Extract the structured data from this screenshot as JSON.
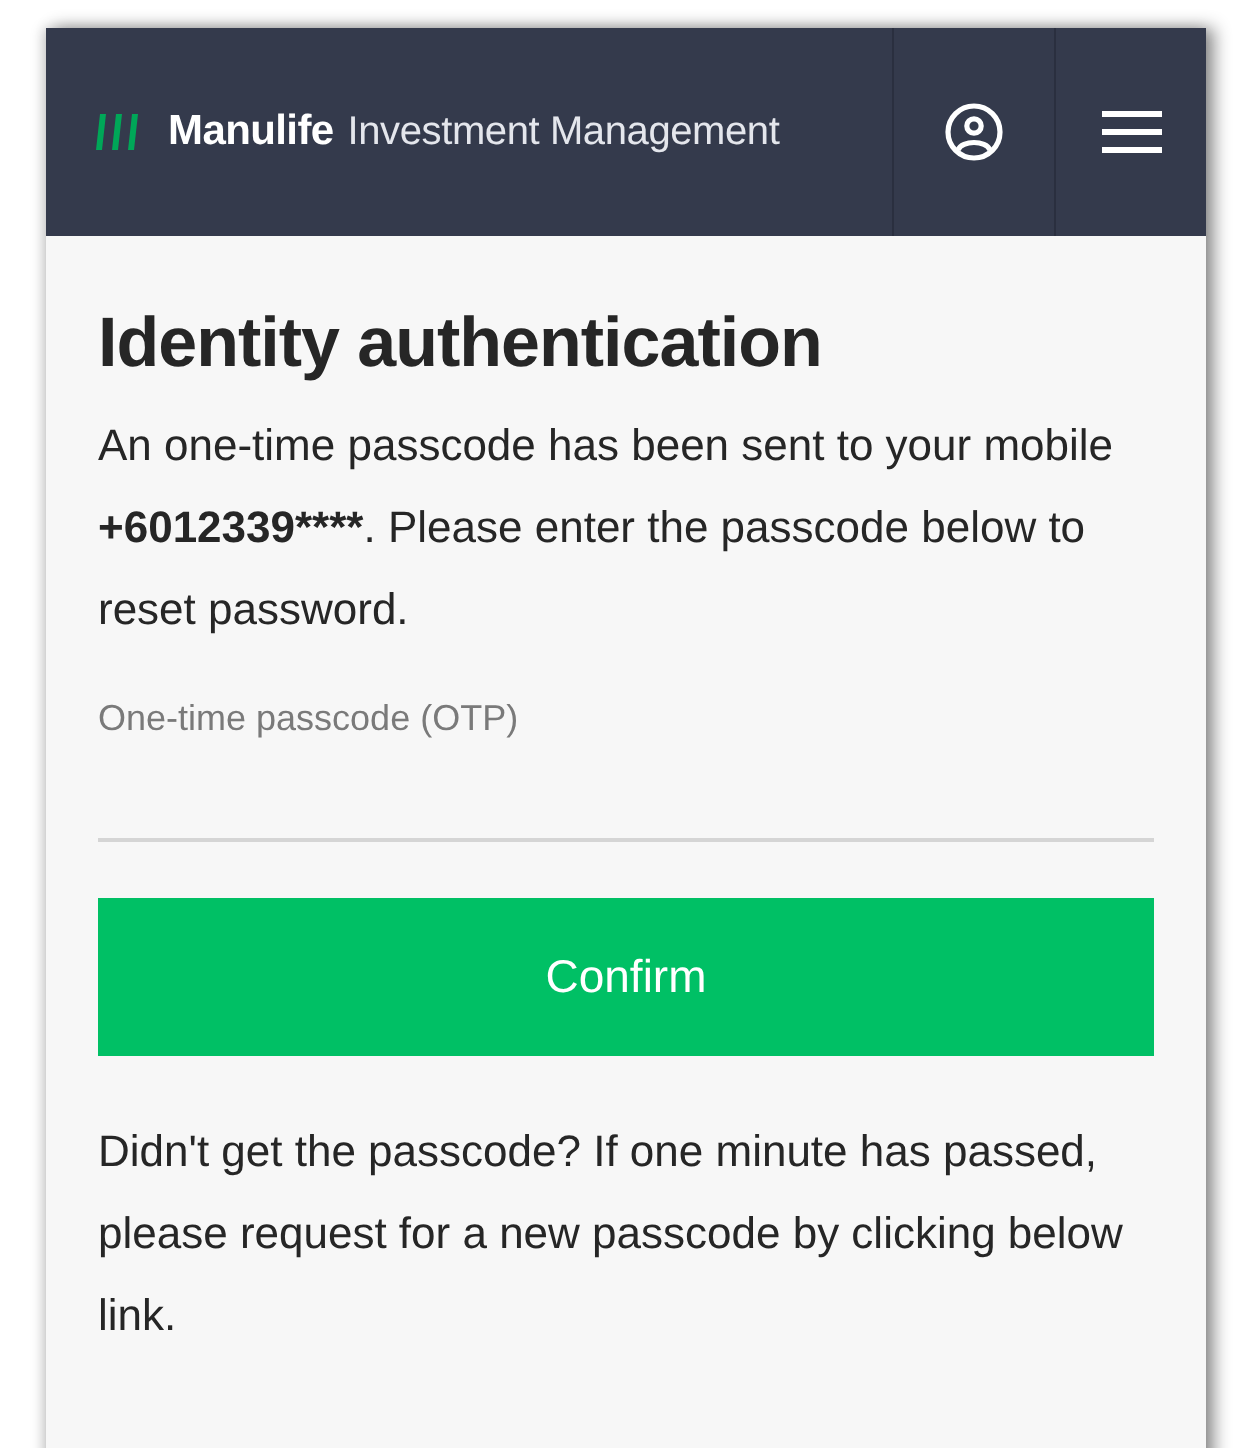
{
  "header": {
    "brand_name": "Manulife",
    "brand_subtitle": "Investment Management"
  },
  "page": {
    "title": "Identity authentication",
    "message": {
      "before": "An one-time passcode has been sent to your mobile ",
      "phone": "+6012339****",
      "after": ". Please enter the passcode below to reset password."
    },
    "otp_field": {
      "label": "One-time passcode (OTP)"
    },
    "confirm_button": "Confirm",
    "help_text": "Didn't get the passcode? If one minute has passed, please request for a new passcode by clicking below link."
  }
}
